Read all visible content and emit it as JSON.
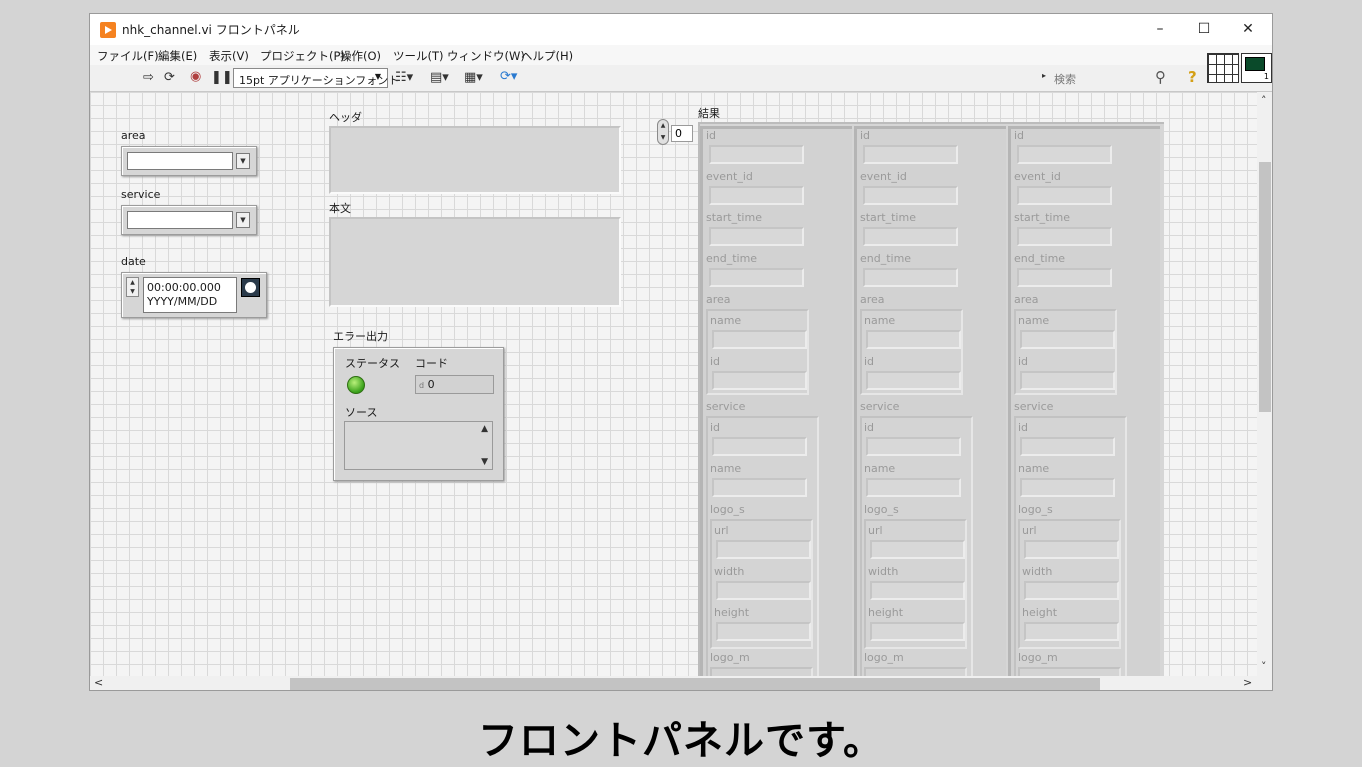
{
  "window": {
    "title": "nhk_channel.vi フロントパネル"
  },
  "menu": [
    "ファイル(F)",
    "編集(E)",
    "表示(V)",
    "プロジェクト(P)",
    "操作(O)",
    "ツール(T)",
    "ウィンドウ(W)",
    "ヘルプ(H)"
  ],
  "toolbar": {
    "font": "15pt アプリケーションフォント",
    "search_placeholder": "検索"
  },
  "icon_number": "1",
  "controls": {
    "area_label": "area",
    "service_label": "service",
    "date_label": "date",
    "date_time": "00:00:00.000",
    "date_format": "YYYY/MM/DD"
  },
  "indicators": {
    "header_label": "ヘッダ",
    "body_label": "本文",
    "result_label": "結果",
    "index_value": "0"
  },
  "error_out": {
    "label": "エラー出力",
    "status_label": "ステータス",
    "code_label": "コード",
    "code_value": "0",
    "code_prefix": "d",
    "source_label": "ソース"
  },
  "result_fields": {
    "id": "id",
    "event_id": "event_id",
    "start_time": "start_time",
    "end_time": "end_time",
    "area": "area",
    "name": "name",
    "service": "service",
    "logo_s": "logo_s",
    "url": "url",
    "width": "width",
    "height": "height",
    "logo_m": "logo_m"
  },
  "caption": "フロントパネルです。",
  "colors": {
    "led_on": "#38a01a",
    "app_icon": "#f58220"
  }
}
